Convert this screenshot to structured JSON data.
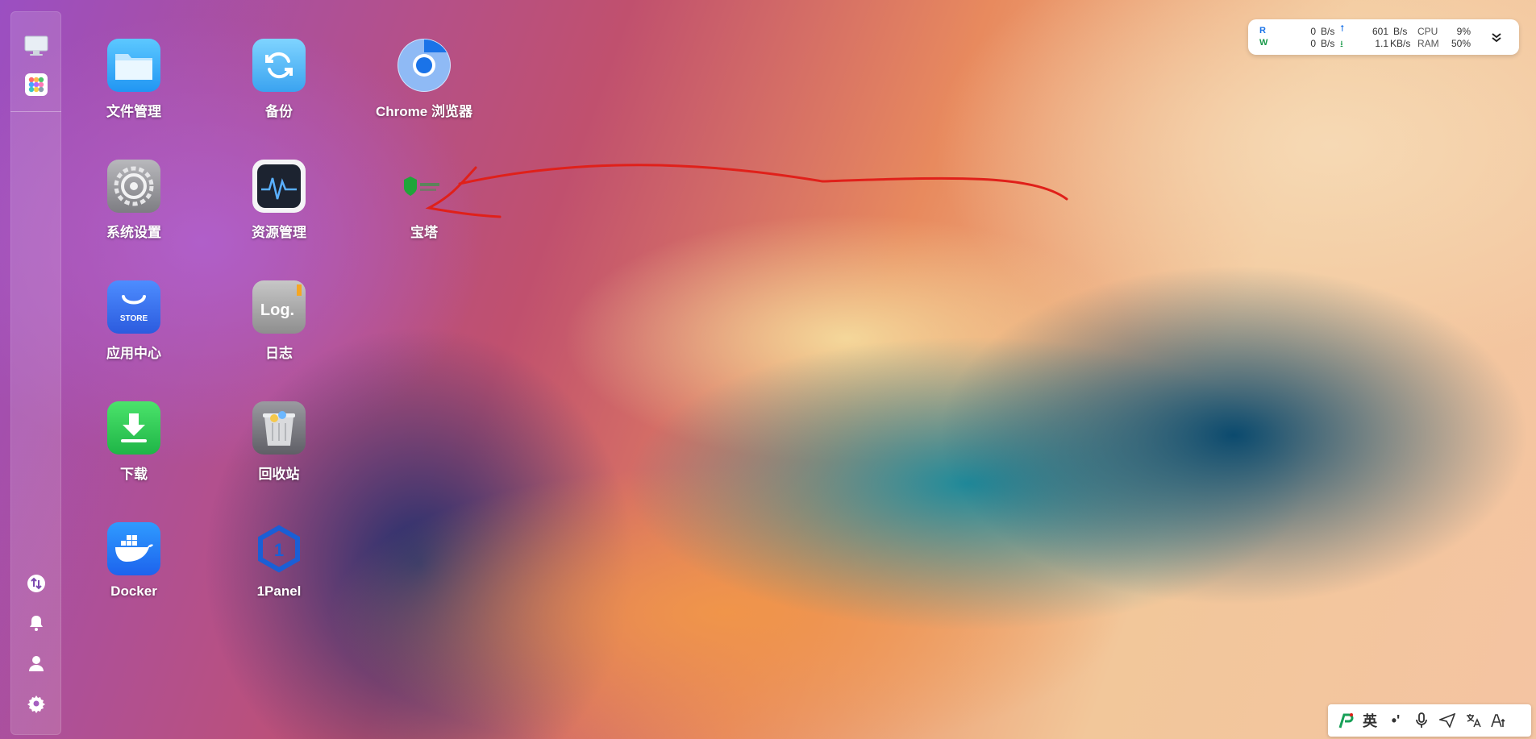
{
  "desktop": {
    "apps": [
      {
        "label": "文件管理",
        "icon": "folder-icon"
      },
      {
        "label": "备份",
        "icon": "sync-icon"
      },
      {
        "label": "Chrome 浏览器",
        "icon": "chrome-icon"
      },
      {
        "label": "系统设置",
        "icon": "gear-icon"
      },
      {
        "label": "资源管理",
        "icon": "activity-monitor-icon"
      },
      {
        "label": "宝塔",
        "icon": "baota-icon"
      },
      {
        "label": "应用中心",
        "icon": "store-icon",
        "tile_text": "STORE"
      },
      {
        "label": "日志",
        "icon": "log-icon",
        "tile_text": "Log."
      },
      {
        "label": "下载",
        "icon": "download-icon"
      },
      {
        "label": "回收站",
        "icon": "trash-icon"
      },
      {
        "label": "Docker",
        "icon": "docker-icon"
      },
      {
        "label": "1Panel",
        "icon": "1panel-icon",
        "tile_text": "1"
      }
    ]
  },
  "monitor": {
    "read_label": "R",
    "write_label": "W",
    "read_value": "0",
    "read_unit": "B/s",
    "write_value": "0",
    "write_unit": "B/s",
    "upload_value": "601",
    "upload_unit": "B/s",
    "download_value": "1.1",
    "download_unit": "KB/s",
    "cpu_label": "CPU",
    "cpu_value": "9%",
    "ram_label": "RAM",
    "ram_value": "50%"
  },
  "ime": {
    "lang": "英",
    "punct": "•'"
  },
  "colors": {
    "annotation_red": "#e0201a",
    "read_color": "#1a73e8",
    "write_color": "#1a9a4a"
  }
}
